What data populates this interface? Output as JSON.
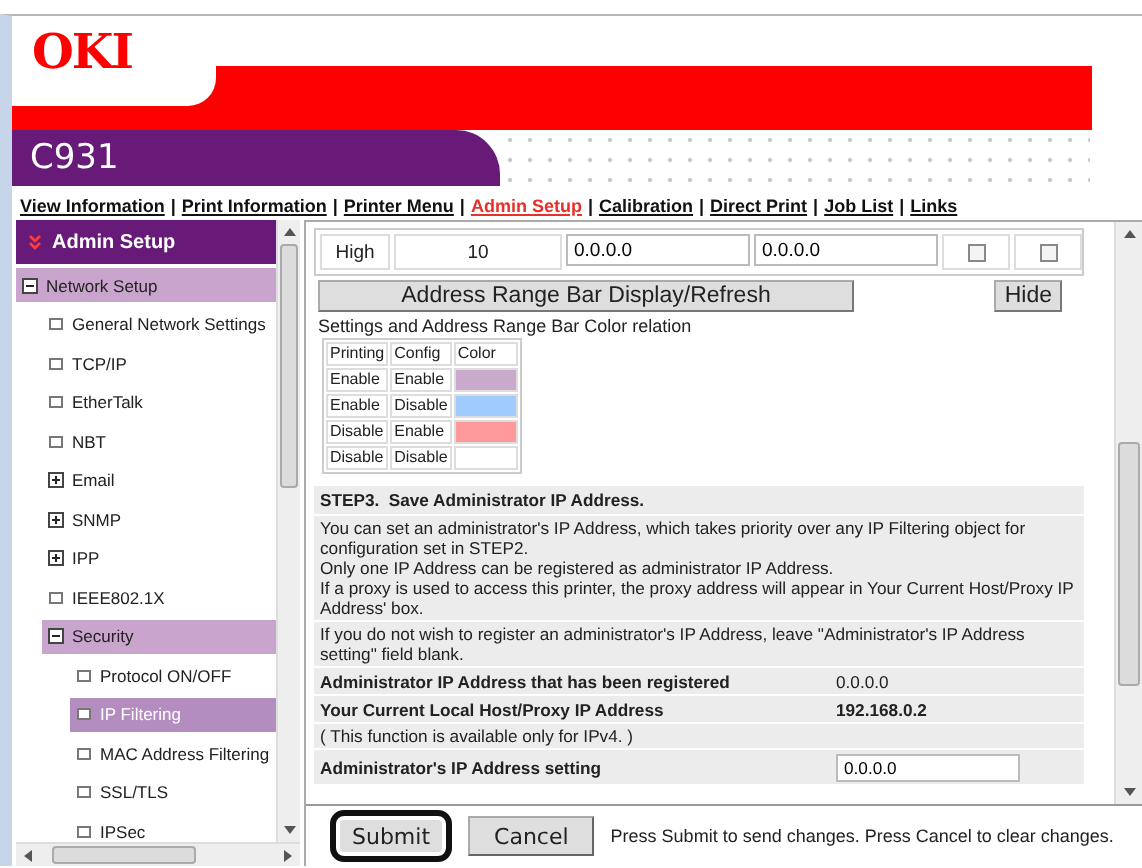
{
  "brand": {
    "logo": "OKI",
    "model": "C931"
  },
  "nav": [
    {
      "kind": "link",
      "label": "View Information",
      "selected": false
    },
    {
      "kind": "separator",
      "label": "|"
    },
    {
      "kind": "link",
      "label": "Print Information",
      "selected": false
    },
    {
      "kind": "separator",
      "label": "|"
    },
    {
      "kind": "link",
      "label": "Printer Menu",
      "selected": false
    },
    {
      "kind": "separator",
      "label": "|"
    },
    {
      "kind": "link",
      "label": "Admin Setup",
      "selected": true
    },
    {
      "kind": "separator",
      "label": "|"
    },
    {
      "kind": "link",
      "label": "Calibration",
      "selected": false
    },
    {
      "kind": "separator",
      "label": "|"
    },
    {
      "kind": "link",
      "label": "Direct Print",
      "selected": false
    },
    {
      "kind": "separator",
      "label": "|"
    },
    {
      "kind": "link",
      "label": "Job List",
      "selected": false
    },
    {
      "kind": "separator",
      "label": "|"
    },
    {
      "kind": "link",
      "label": "Links",
      "selected": false
    }
  ],
  "sidebar": {
    "title": "Admin Setup",
    "items": [
      {
        "label": "Network Setup",
        "kind": "branch",
        "expanded": true,
        "selected": false,
        "children": [
          {
            "label": "General Network Settings",
            "kind": "leaf",
            "selected": false
          },
          {
            "label": "TCP/IP",
            "kind": "leaf",
            "selected": false
          },
          {
            "label": "EtherTalk",
            "kind": "leaf",
            "selected": false
          },
          {
            "label": "NBT",
            "kind": "leaf",
            "selected": false
          },
          {
            "label": "Email",
            "kind": "branch",
            "expanded": false,
            "selected": false
          },
          {
            "label": "SNMP",
            "kind": "branch",
            "expanded": false,
            "selected": false
          },
          {
            "label": "IPP",
            "kind": "branch",
            "expanded": false,
            "selected": false
          },
          {
            "label": "IEEE802.1X",
            "kind": "leaf",
            "selected": false
          },
          {
            "label": "Security",
            "kind": "branch",
            "expanded": true,
            "selected": false,
            "children": [
              {
                "label": "Protocol ON/OFF",
                "kind": "leaf",
                "selected": false
              },
              {
                "label": "IP Filtering",
                "kind": "leaf",
                "selected": true
              },
              {
                "label": "MAC Address Filtering",
                "kind": "leaf",
                "selected": false
              },
              {
                "label": "SSL/TLS",
                "kind": "leaf",
                "selected": false
              },
              {
                "label": "IPSec",
                "kind": "leaf",
                "selected": false
              }
            ]
          }
        ]
      }
    ]
  },
  "filter_table": {
    "rows": [
      {
        "column_1": "High",
        "column_2": "10",
        "start": "0.0.0.0",
        "end": "0.0.0.0",
        "checkbox_1": false,
        "checkbox_2": false
      }
    ]
  },
  "range_bar": {
    "button": "Address Range Bar Display/Refresh",
    "hide_button": "Hide",
    "caption": "Settings and Address Range Bar Color relation",
    "legend": {
      "columns": [
        "Printing",
        "Config",
        "Color"
      ],
      "rows": [
        {
          "printing": "Enable",
          "config": "Enable",
          "color": "#c9aacc"
        },
        {
          "printing": "Enable",
          "config": "Disable",
          "color": "#9fcbff"
        },
        {
          "printing": "Disable",
          "config": "Enable",
          "color": "#ff9a9a"
        },
        {
          "printing": "Disable",
          "config": "Disable",
          "color": "#ffffff"
        }
      ]
    }
  },
  "step3": {
    "title": "STEP3.  Save Administrator IP Address.",
    "description": [
      "You can set an administrator's IP Address, which takes priority over any IP Filtering object for configuration set in STEP2.",
      "Only one IP Address can be registered as administrator IP Address.",
      "If a proxy is used to access this printer, the proxy address will appear in Your Current Host/Proxy IP Address' box."
    ],
    "note": "If you do not wish to register an administrator's IP Address, leave \"Administrator's IP Address setting\" field blank.",
    "fields": [
      {
        "label": "Administrator IP Address that has been registered",
        "value": "0.0.0.0",
        "emphasis": false
      },
      {
        "label": "Your Current Local Host/Proxy IP Address",
        "value": "192.168.0.2",
        "emphasis": true
      }
    ],
    "ipv4_note": "( This function is available only for IPv4. )",
    "setting": {
      "label": "Administrator's IP Address setting",
      "value": "0.0.0.0"
    }
  },
  "footer": {
    "buttons": [
      {
        "label": "Submit",
        "highlighted": true
      },
      {
        "label": "Cancel",
        "highlighted": false
      }
    ],
    "hint": "Press Submit to send changes. Press Cancel to clear changes."
  }
}
